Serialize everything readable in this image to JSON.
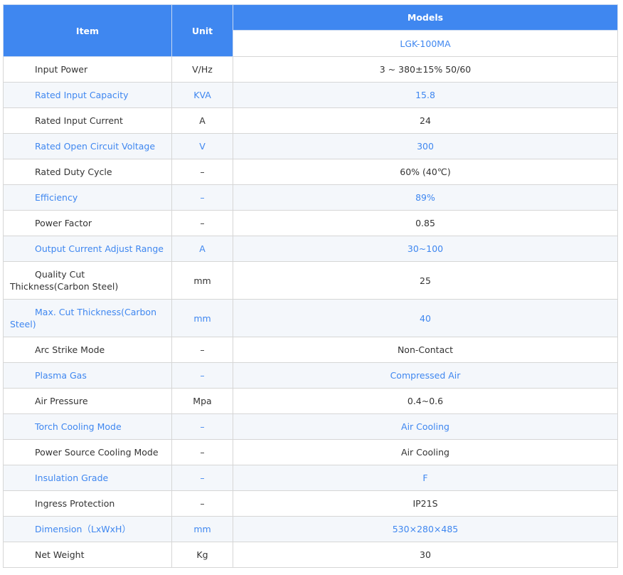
{
  "header": {
    "item": "Item",
    "unit": "Unit",
    "models": "Models",
    "model_name": "LGK-100MA"
  },
  "rows": [
    {
      "item": "Input Power",
      "unit": "V/Hz",
      "value": "3 ~ 380±15% 50/60"
    },
    {
      "item": "Rated Input Capacity",
      "unit": "KVA",
      "value": "15.8"
    },
    {
      "item": "Rated Input Current",
      "unit": "A",
      "value": "24"
    },
    {
      "item": "Rated Open Circuit Voltage",
      "unit": "V",
      "value": "300"
    },
    {
      "item": "Rated Duty Cycle",
      "unit": "–",
      "value": "60% (40℃)"
    },
    {
      "item": "Efficiency",
      "unit": "–",
      "value": "89%"
    },
    {
      "item": "Power Factor",
      "unit": "–",
      "value": "0.85"
    },
    {
      "item": "Output Current Adjust Range",
      "unit": "A",
      "value": "30~100"
    },
    {
      "item": "Quality Cut Thickness(Carbon Steel)",
      "unit": "mm",
      "value": "25"
    },
    {
      "item": "Max. Cut Thickness(Carbon Steel)",
      "unit": "mm",
      "value": "40"
    },
    {
      "item": "Arc Strike Mode",
      "unit": "–",
      "value": "Non-Contact"
    },
    {
      "item": "Plasma Gas",
      "unit": "–",
      "value": "Compressed Air"
    },
    {
      "item": "Air Pressure",
      "unit": "Mpa",
      "value": "0.4~0.6"
    },
    {
      "item": "Torch Cooling Mode",
      "unit": "–",
      "value": "Air Cooling"
    },
    {
      "item": "Power Source Cooling Mode",
      "unit": "–",
      "value": "Air Cooling"
    },
    {
      "item": "Insulation Grade",
      "unit": "–",
      "value": "F"
    },
    {
      "item": "Ingress Protection",
      "unit": "–",
      "value": "IP21S"
    },
    {
      "item": "Dimension（LxWxH）",
      "unit": "mm",
      "value": "530×280×485"
    },
    {
      "item": "Net Weight",
      "unit": "Kg",
      "value": "30"
    }
  ],
  "colors": {
    "header_bg": "#3f87f0",
    "accent_text": "#3f87f0",
    "alt_row_bg": "#f4f7fb",
    "text": "#333333",
    "border": "#d6d6d6"
  }
}
